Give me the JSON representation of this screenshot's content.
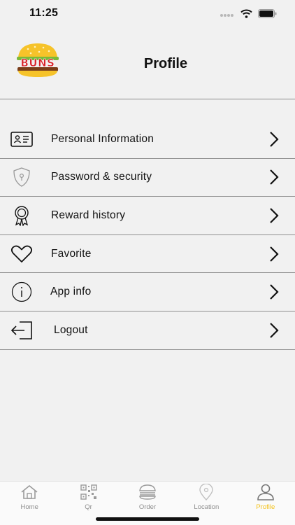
{
  "status_bar": {
    "time": "11:25"
  },
  "header": {
    "logo_text": "BUNS",
    "title": "Profile"
  },
  "menu": {
    "items": [
      {
        "label": "Personal Information",
        "icon": "id-card-icon"
      },
      {
        "label": "Password & security",
        "icon": "shield-key-icon"
      },
      {
        "label": "Reward history",
        "icon": "award-ribbon-icon"
      },
      {
        "label": "Favorite",
        "icon": "heart-icon"
      },
      {
        "label": "App info",
        "icon": "info-icon"
      },
      {
        "label": "Logout",
        "icon": "logout-icon"
      }
    ]
  },
  "tabbar": {
    "tabs": [
      {
        "label": "Home",
        "icon": "home-icon",
        "active": false
      },
      {
        "label": "Qr",
        "icon": "qr-code-icon",
        "active": false
      },
      {
        "label": "Order",
        "icon": "burger-icon",
        "active": false
      },
      {
        "label": "Location",
        "icon": "location-pin-icon",
        "active": false
      },
      {
        "label": "Profile",
        "icon": "user-icon",
        "active": true
      }
    ]
  },
  "colors": {
    "background": "#f1f1f1",
    "accent": "#f4c21b",
    "logo_red": "#d8232a",
    "tab_inactive": "#8e8e8e"
  }
}
